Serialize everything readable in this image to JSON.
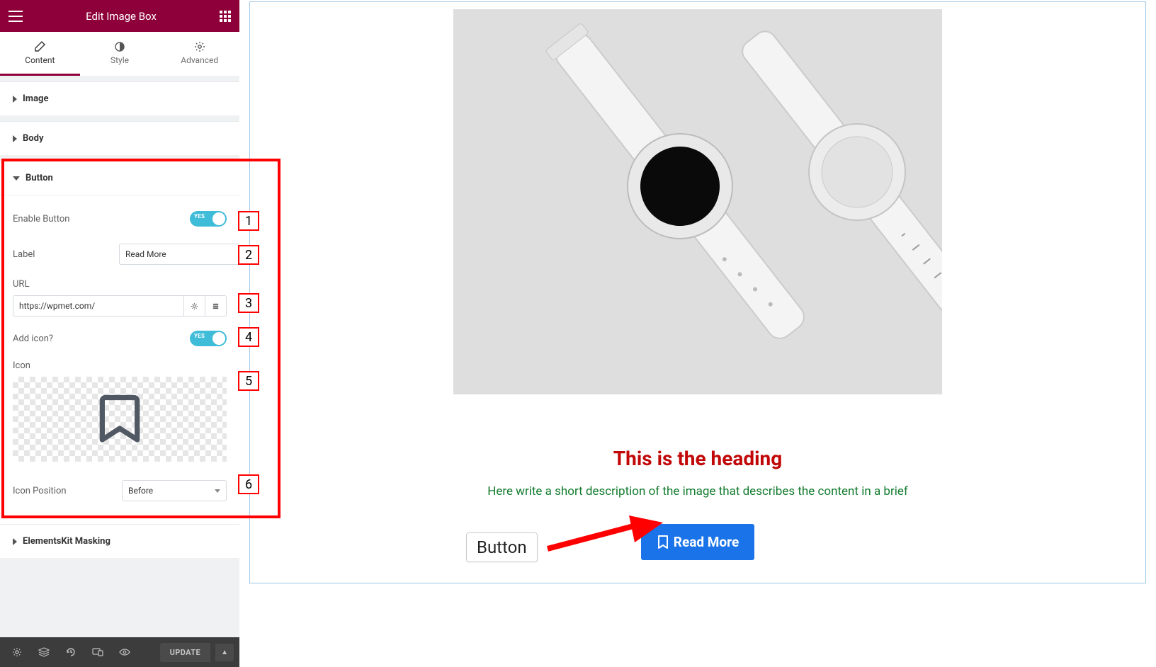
{
  "header": {
    "title": "Edit Image Box"
  },
  "tabs": {
    "content": "Content",
    "style": "Style",
    "advanced": "Advanced"
  },
  "accordions": {
    "image": "Image",
    "body": "Body",
    "button": "Button",
    "elementskit_masking": "ElementsKit Masking"
  },
  "button_section": {
    "enable_label": "Enable Button",
    "enable_on_text": "YES",
    "label_label": "Label",
    "label_value": "Read More",
    "url_label": "URL",
    "url_value": "https://wpmet.com/",
    "addicon_label": "Add icon?",
    "addicon_on_text": "YES",
    "icon_label": "Icon",
    "iconpos_label": "Icon Position",
    "iconpos_value": "Before"
  },
  "annotations": {
    "n1": "1",
    "n2": "2",
    "n3": "3",
    "n4": "4",
    "n5": "5",
    "n6": "6",
    "button_callout": "Button"
  },
  "footer": {
    "update": "UPDATE"
  },
  "preview": {
    "heading": "This is the heading",
    "desc": "Here write a short description of the image that describes the content in a brief",
    "cta": "Read More"
  }
}
